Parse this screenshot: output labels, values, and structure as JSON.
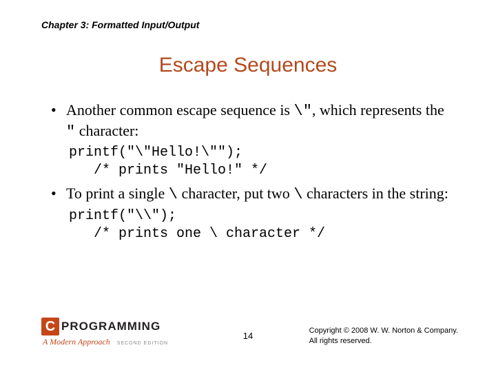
{
  "chapter": "Chapter 3: Formatted Input/Output",
  "title": "Escape Sequences",
  "bullets": [
    {
      "pre": "Another common escape sequence is ",
      "code1": "\\\"",
      "mid": ", which represents the ",
      "code2": "\"",
      "post": " character:"
    },
    {
      "pre": "To print a single ",
      "code1": "\\",
      "mid": " character, put two ",
      "code2": "\\",
      "post": " characters in the string:"
    }
  ],
  "codes": [
    "printf(\"\\\"Hello!\\\"\");\n   /* prints \"Hello!\" */",
    "printf(\"\\\\\");\n   /* prints one \\ character */"
  ],
  "logo": {
    "c": "C",
    "word": "PROGRAMMING",
    "sub": "A Modern Approach",
    "edition": "SECOND EDITION"
  },
  "page": "14",
  "copyright": {
    "line1": "Copyright © 2008 W. W. Norton & Company.",
    "line2": "All rights reserved."
  }
}
